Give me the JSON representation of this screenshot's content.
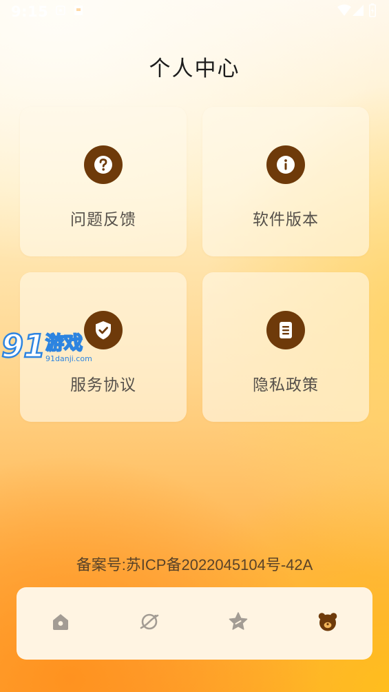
{
  "status_bar": {
    "time": "9:15",
    "icons": [
      "gallery-icon",
      "notification-icon",
      "wifi-icon",
      "signal-icon",
      "battery-icon"
    ]
  },
  "header": {
    "title": "个人中心"
  },
  "cards": [
    {
      "label": "问题反馈",
      "icon": "question-icon"
    },
    {
      "label": "软件版本",
      "icon": "info-icon"
    },
    {
      "label": "服务协议",
      "icon": "shield-check-icon"
    },
    {
      "label": "隐私政策",
      "icon": "document-icon"
    }
  ],
  "watermark": {
    "brand": "91游戏",
    "domain": "91danji.com"
  },
  "footer": {
    "icp": "备案号:苏ICP备2022045104号-42A"
  },
  "bottom_nav": {
    "items": [
      {
        "name": "home",
        "icon": "home-icon",
        "active": false
      },
      {
        "name": "explore",
        "icon": "planet-icon",
        "active": false
      },
      {
        "name": "favorites",
        "icon": "star-icon",
        "active": false
      },
      {
        "name": "profile",
        "icon": "bear-icon",
        "active": true
      }
    ]
  },
  "colors": {
    "accent": "#6e3a0a",
    "nav_inactive": "#a39c94",
    "card_bg": "#fff8e8",
    "title": "#1c1c1c"
  }
}
